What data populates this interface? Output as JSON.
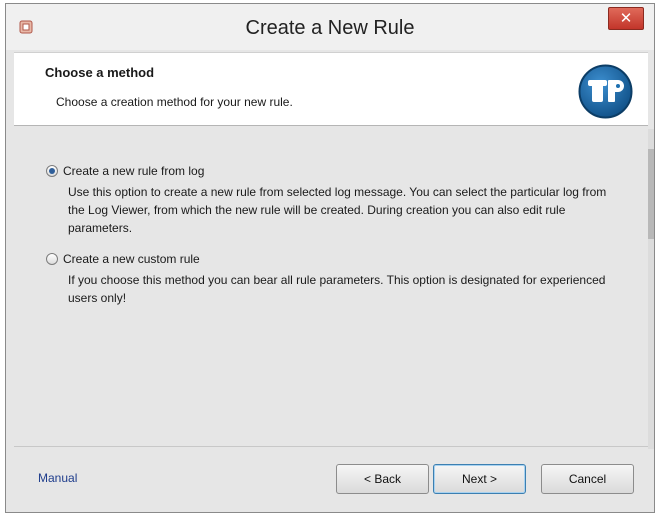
{
  "window": {
    "title": "Create a New Rule",
    "close_label": "✕"
  },
  "header": {
    "title": "Choose a method",
    "subtitle": "Choose a creation method for your new rule."
  },
  "options": [
    {
      "label": "Create a new rule from log",
      "description": "Use this option to create a new rule from selected log message. You can select the particular log from the Log Viewer, from which the new rule will be created. During creation you can also edit rule parameters.",
      "selected": true
    },
    {
      "label": "Create a new custom rule",
      "description": "If you choose this method you can bear all rule parameters. This option is designated for experienced users only!",
      "selected": false
    }
  ],
  "footer": {
    "manual_label": "Manual",
    "back_label": "< Back",
    "next_label": "Next >",
    "cancel_label": "Cancel"
  },
  "colors": {
    "accent": "#1f3d8c",
    "logo": "#1d6fb0"
  },
  "icons": {
    "app": "app-icon",
    "logo": "logo-icon",
    "close": "close-icon"
  }
}
